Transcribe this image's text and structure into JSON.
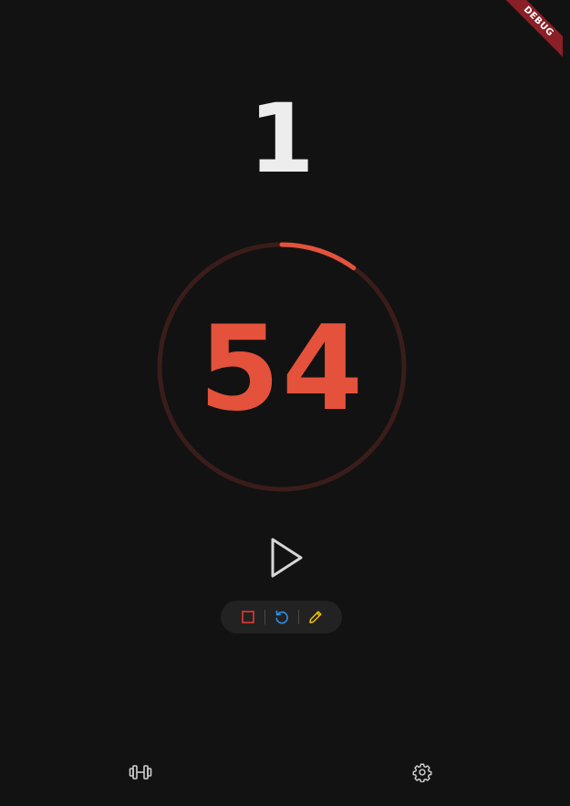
{
  "round": {
    "value": "1"
  },
  "timer": {
    "seconds": "54",
    "progress_fraction": 0.1,
    "accent_color": "#e4523b",
    "track_color": "#3a1d1a"
  },
  "controls": {
    "play_icon": "play-icon",
    "stop_icon": "stop-icon",
    "reset_icon": "reset-icon",
    "edit_icon": "edit-icon",
    "stop_color": "#e53935",
    "reset_color": "#2f8ee6",
    "edit_color": "#f2c200"
  },
  "bottom_nav": {
    "workouts_icon": "dumbbell-icon",
    "settings_icon": "gear-icon"
  },
  "debug_banner": {
    "label": "DEBUG"
  }
}
